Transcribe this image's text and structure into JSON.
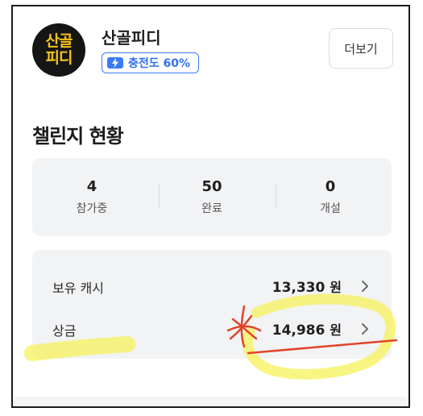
{
  "profile": {
    "avatar_line1": "산골",
    "avatar_line2": "피디",
    "name": "산골피디",
    "charge_badge": "충전도 60%",
    "more_button": "더보기"
  },
  "challenge": {
    "title": "챌린지 현황",
    "stats": [
      {
        "value": "4",
        "label": "참가중"
      },
      {
        "value": "50",
        "label": "완료"
      },
      {
        "value": "0",
        "label": "개설"
      }
    ]
  },
  "money": {
    "rows": [
      {
        "label": "보유 캐시",
        "amount": "13,330",
        "unit": "원"
      },
      {
        "label": "상금",
        "amount": "14,986",
        "unit": "원"
      }
    ]
  },
  "colors": {
    "accent_blue": "#3a7bf5",
    "avatar_text": "#f6c41b",
    "highlighter": "#f7f25a",
    "pen_red": "#e0442a"
  }
}
